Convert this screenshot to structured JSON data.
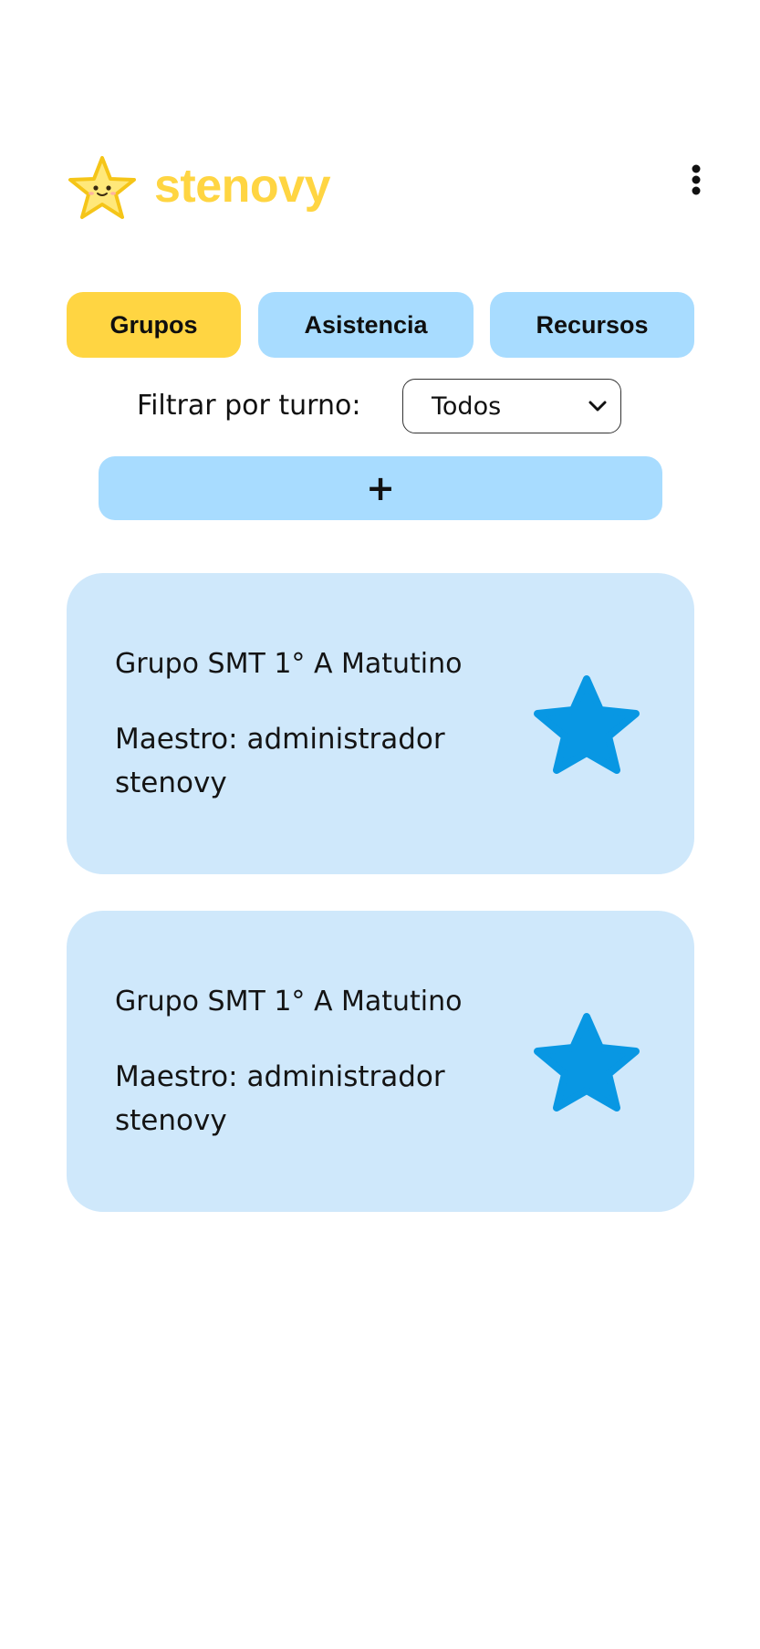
{
  "app": {
    "brand": "stenovy",
    "brand_color": "#ffd542"
  },
  "tabs": [
    {
      "label": "Grupos",
      "active": true
    },
    {
      "label": "Asistencia",
      "active": false
    },
    {
      "label": "Recursos",
      "active": false
    }
  ],
  "filter": {
    "label": "Filtrar por turno:",
    "selected": "Todos"
  },
  "add_button": {
    "label": "+"
  },
  "groups": [
    {
      "title": "Grupo SMT 1° A Matutino",
      "teacher_line1": "Maestro: administrador",
      "teacher_line2": "stenovy",
      "icon": "star-icon"
    },
    {
      "title": "Grupo SMT 1° A Matutino",
      "teacher_line1": "Maestro: administrador",
      "teacher_line2": "stenovy",
      "icon": "star-icon"
    }
  ],
  "colors": {
    "tab_active": "#ffd542",
    "tab_inactive": "#a8dcff",
    "card_bg": "#cfe8fb",
    "star": "#0897e3"
  }
}
